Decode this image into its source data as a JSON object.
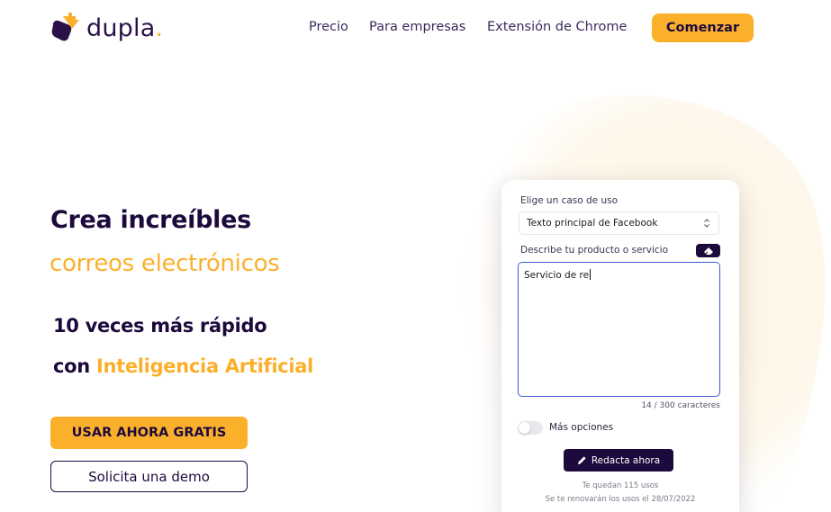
{
  "brand": {
    "name": "dupla",
    "dot": ".",
    "logo_icon": "dupla-logo-icon",
    "colors": {
      "accent": "#fbb02c",
      "dark": "#1d0a3c",
      "focus": "#3d5ccc"
    }
  },
  "nav": {
    "items": [
      "Precio",
      "Para empresas",
      "Extensión de Chrome"
    ],
    "cta": "Comenzar"
  },
  "hero": {
    "line1": "Crea increíbles",
    "line2": "correos electrónicos",
    "line3": "10 veces más rápido",
    "line4_prefix": "con ",
    "line4_highlight": "Inteligencia Artificial",
    "primary_button": "USAR AHORA GRATIS",
    "secondary_button": "Solicita una demo"
  },
  "card": {
    "use_case_label": "Elige un caso de uso",
    "use_case_value": "Texto principal de Facebook",
    "describe_label": "Describe tu producto o servicio",
    "clear_icon": "eraser-icon",
    "textarea_value": "Servicio de re",
    "counter": "14 / 300 caracteres",
    "more_options_label": "Más opciones",
    "more_options_on": false,
    "write_button": "Redacta ahora",
    "write_icon": "pencil-icon",
    "uses_left": "Te quedan 115 usos",
    "renewal": "Se te renovarán los usos el 28/07/2022"
  }
}
